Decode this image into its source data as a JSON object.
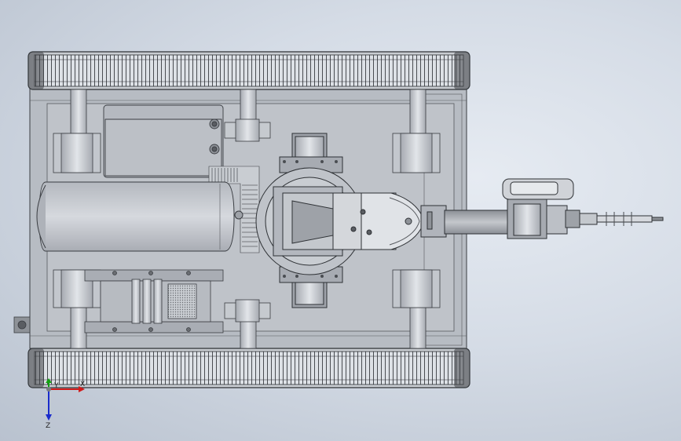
{
  "scene": {
    "background_color": "#d5dce6",
    "body_fill": "#b9bec5",
    "part_fill": "#c6cacf",
    "line_color": "#3a3d42",
    "track_fill": "#d9dde2"
  },
  "triad": {
    "y_label": "Y",
    "x_label": "X",
    "z_label": "Z",
    "x_color": "#d11a1a",
    "y_color": "#13a313",
    "z_color": "#1a2bcc"
  },
  "icons": [
    "triad-icon"
  ]
}
